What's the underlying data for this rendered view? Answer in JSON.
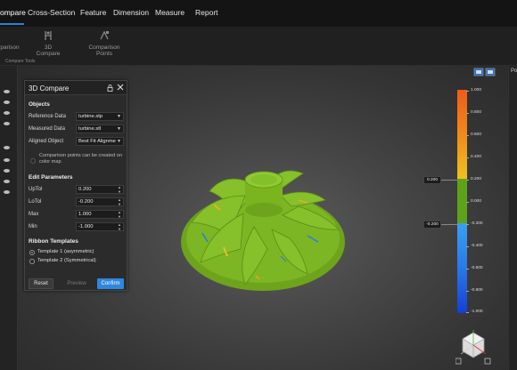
{
  "menu": {
    "items": [
      "ompare",
      "Cross-Section",
      "Feature",
      "Dimension",
      "Measure",
      "Report"
    ]
  },
  "ribbon": {
    "buttons": [
      "parison",
      "3D Compare",
      "Comparison Points"
    ],
    "group_label": "Compare Tools"
  },
  "right_edge_label": "Po",
  "dialog": {
    "title": "3D Compare",
    "objects_header": "Objects",
    "reference_label": "Reference Data",
    "reference_value": "turbine.stp",
    "measured_label": "Measured Data",
    "measured_value": "turbine.stl",
    "aligned_label": "Aligned Object",
    "aligned_value": "Best Fit Alignme",
    "note": "Comparison points can be created on color map",
    "edit_header": "Edit Parameters",
    "uptol_label": "UpTol",
    "uptol_value": "0.200",
    "lotol_label": "LoTol",
    "lotol_value": "-0.200",
    "max_label": "Max",
    "max_value": "1.000",
    "min_label": "Min",
    "min_value": "-1.000",
    "ribbon_header": "Ribbon Templates",
    "template1": "Template 1 (asymmetric)",
    "template2": "Template 2 (Symmetrical)",
    "template_selected": "Template 1 (asymmetric)",
    "reset": "Reset",
    "preview": "Preview",
    "confirm": "Confirm"
  },
  "color_scale": {
    "ticks": [
      "1.000",
      "0.800",
      "0.600",
      "0.400",
      "0.200",
      "0.000",
      "-0.200",
      "-0.400",
      "-0.600",
      "-0.800",
      "-1.000"
    ],
    "upper_tol": "0.200",
    "lower_tol": "-0.200",
    "colors": {
      "top": "#f05a1c",
      "upper_mid": "#f0a01c",
      "tolerance": "#5ea21a",
      "lower_mid": "#2b8ff0",
      "bottom": "#1240d8"
    }
  },
  "colors": {
    "accent": "#2f86dd",
    "part_green": "#7ab520"
  }
}
